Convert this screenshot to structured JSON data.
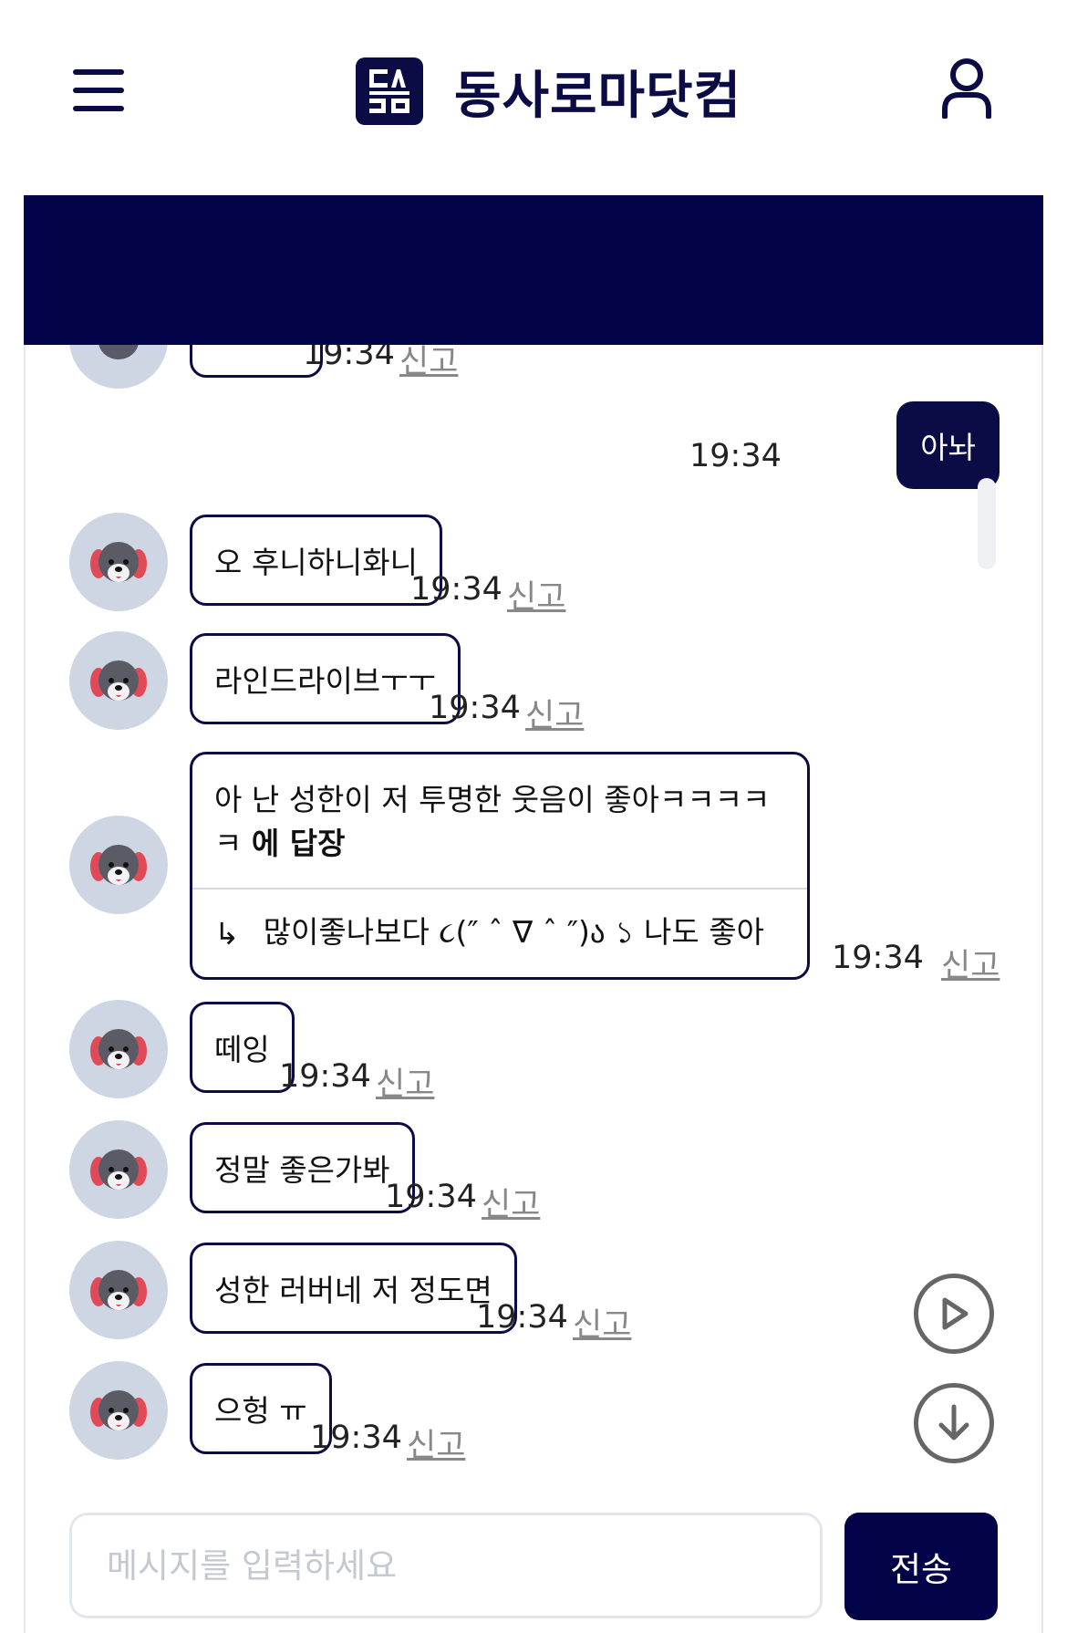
{
  "header": {
    "title": "동사로마닷컴",
    "logo_text": "동사로마"
  },
  "messages": [
    {
      "type": "partial",
      "time": "19:34",
      "report": "신고"
    },
    {
      "type": "mine",
      "text": "아놔",
      "time": "19:34"
    },
    {
      "type": "other",
      "text": "오 후니하니화니",
      "time": "19:34",
      "report": "신고"
    },
    {
      "type": "other",
      "text": "라인드라이브ㅜㅜ",
      "time": "19:34",
      "report": "신고"
    },
    {
      "type": "reply",
      "quoted_line1": "아 난 성한이 저 투명한 웃음이 좋아ㅋㅋㅋㅋ",
      "quoted_line2_plain": "ㅋ",
      "quoted_suffix": "에 답장",
      "reply_arrow": "↳",
      "reply_text": "많이좋나보다 ૮(″ ˆ ∇ ˆ ″)ა ১ 나도 좋아",
      "time": "19:34",
      "report": "신고"
    },
    {
      "type": "other",
      "text": "떼잉",
      "time": "19:34",
      "report": "신고"
    },
    {
      "type": "other",
      "text": "정말 좋은가봐",
      "time": "19:34",
      "report": "신고"
    },
    {
      "type": "other",
      "text": "성한 러버네 저 정도면",
      "time": "19:34",
      "report": "신고"
    },
    {
      "type": "other",
      "text": "으헝 ㅠ",
      "time": "19:34",
      "report": "신고"
    }
  ],
  "input": {
    "placeholder": "메시지를 입력하세요",
    "value": ""
  },
  "send_label": "전송",
  "colors": {
    "brand": "#0b0b45",
    "banner": "#03034a",
    "avatar_bg": "#cfd6e3",
    "report_text": "#888888"
  },
  "icons": [
    "menu-icon",
    "user-icon",
    "play-icon",
    "arrow-down-icon",
    "bear-avatar-icon"
  ]
}
